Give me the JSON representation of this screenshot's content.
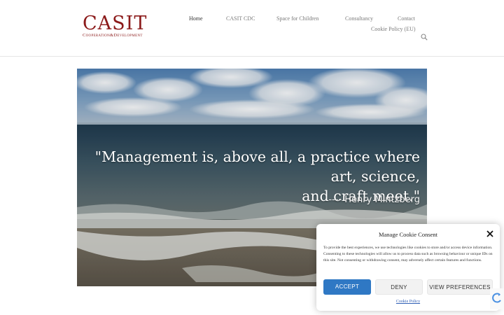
{
  "logo": {
    "main": "CASIT",
    "sub": "Cooperation&Development"
  },
  "nav": {
    "items": [
      {
        "label": "Home"
      },
      {
        "label": "CASIT CDC"
      },
      {
        "label": "Space for Children"
      },
      {
        "label": "Consultancy"
      },
      {
        "label": "Contact"
      },
      {
        "label": "Cookie Policy (EU)"
      }
    ],
    "active_color": "#333333"
  },
  "hero": {
    "quote_line1": "\"Management is, above all, a practice where art, science,",
    "quote_line2": "and craft meet.\"",
    "author": "---- Henry Mintzberg"
  },
  "cookie": {
    "title": "Manage Cookie Consent",
    "text": "To provide the best experiences, we use technologies like cookies to store and/or access device information. Consenting to these technologies will allow us to process data such as browsing behaviour or unique IDs on this site. Not consenting or withdrawing consent, may adversely affect certain features and functions.",
    "accept_label": "ACCEPT",
    "deny_label": "DENY",
    "prefs_label": "VIEW PREFERENCES",
    "policy_link": "Cookie Policy",
    "accept_color": "#2f78c4"
  },
  "colors": {
    "brand": "#8b1a1a",
    "link": "#2f5fb5"
  },
  "icons": {
    "search": "search-icon",
    "close": "close-icon",
    "recaptcha": "recaptcha-icon"
  }
}
